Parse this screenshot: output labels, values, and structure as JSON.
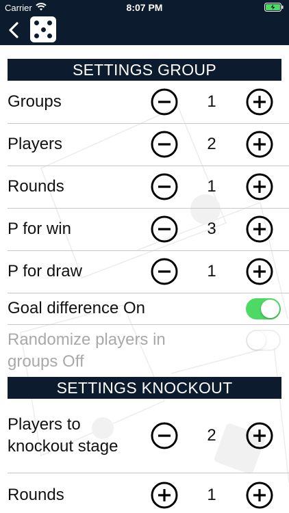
{
  "status_bar": {
    "carrier": "Carrier",
    "time": "8:07 PM",
    "wifi_icon": "wifi-icon",
    "battery_icon": "battery-charging-icon"
  },
  "nav": {
    "back_icon": "chevron-left-icon",
    "logo_icon": "dice-icon"
  },
  "colors": {
    "nav_bg": "#0d1b2e",
    "header_bg": "#0d1b2e",
    "toggle_on": "#4cd964",
    "disabled_text": "#a9a9a9"
  },
  "group_settings": {
    "header": "SETTINGS GROUP",
    "steppers": [
      {
        "label": "Groups",
        "value": "1"
      },
      {
        "label": "Players",
        "value": "2"
      },
      {
        "label": "Rounds",
        "value": "1"
      },
      {
        "label": "P for win",
        "value": "3"
      },
      {
        "label": "P for draw",
        "value": "1"
      }
    ],
    "goal_difference": {
      "label": "Goal difference On",
      "on": true
    },
    "randomize": {
      "label_line1": "Randomize players in",
      "label_line2": "groups Off",
      "on": false,
      "enabled": false
    }
  },
  "knockout_settings": {
    "header": "SETTINGS KNOCKOUT",
    "players_to_knockout": {
      "label_line1": "Players to",
      "label_line2": "knockout stage",
      "value": "2"
    },
    "rounds": {
      "label": "Rounds",
      "value": "1"
    }
  }
}
